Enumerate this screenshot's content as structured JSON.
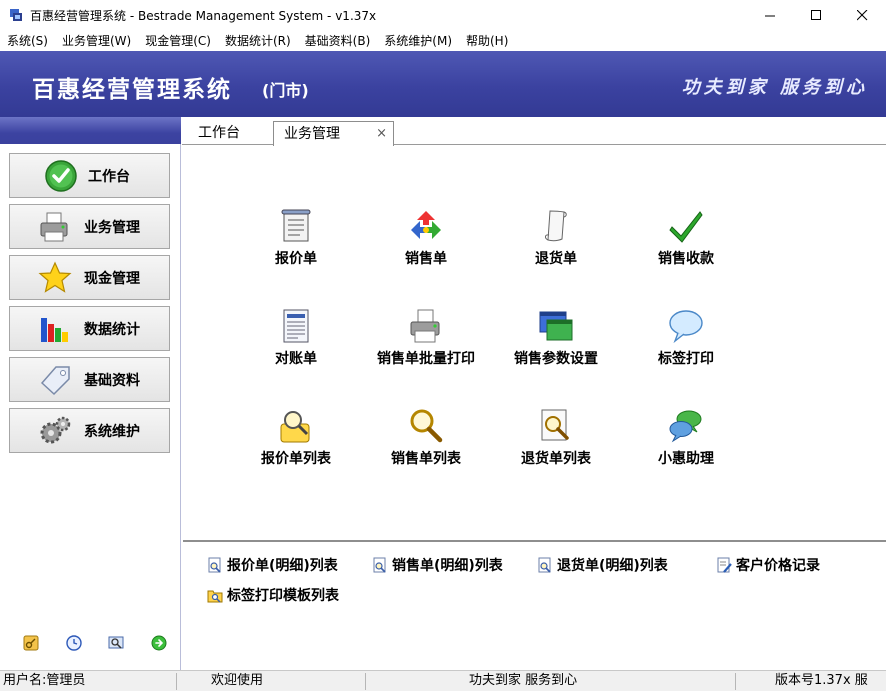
{
  "window": {
    "title": "百惠经营管理系统 - Bestrade Management System - v1.37x",
    "icon": "app-icon"
  },
  "menu": [
    {
      "label": "系统(S)"
    },
    {
      "label": "业务管理(W)"
    },
    {
      "label": "现金管理(C)"
    },
    {
      "label": "数据统计(R)"
    },
    {
      "label": "基础资料(B)"
    },
    {
      "label": "系统维护(M)"
    },
    {
      "label": "帮助(H)"
    }
  ],
  "banner": {
    "name": "百惠经营管理系统",
    "subtitle": "(门市)",
    "slogan": "功夫到家 服务到心",
    "color": "#3b42a0"
  },
  "sidebar": {
    "items": [
      {
        "label": "工作台",
        "icon": "check-circle-icon"
      },
      {
        "label": "业务管理",
        "icon": "printer-icon"
      },
      {
        "label": "现金管理",
        "icon": "star-icon"
      },
      {
        "label": "数据统计",
        "icon": "bar-chart-icon"
      },
      {
        "label": "基础资料",
        "icon": "tag-icon"
      },
      {
        "label": "系统维护",
        "icon": "gears-icon"
      }
    ],
    "footer_icons": [
      "key-icon",
      "clock-icon",
      "search-window-icon",
      "forward-icon"
    ]
  },
  "tabs": [
    {
      "label": "工作台",
      "active": false
    },
    {
      "label": "业务管理",
      "active": true,
      "close": "×"
    }
  ],
  "tiles": [
    {
      "label": "报价单",
      "icon": "document-icon"
    },
    {
      "label": "销售单",
      "icon": "recycle-icon"
    },
    {
      "label": "退货单",
      "icon": "scroll-icon"
    },
    {
      "label": "销售收款",
      "icon": "checkmark-icon"
    },
    {
      "label": "对账单",
      "icon": "list-document-icon"
    },
    {
      "label": "销售单批量打印",
      "icon": "printer-icon"
    },
    {
      "label": "销售参数设置",
      "icon": "window-settings-icon"
    },
    {
      "label": "标签打印",
      "icon": "speech-bubble-icon"
    },
    {
      "label": "报价单列表",
      "icon": "user-search-icon"
    },
    {
      "label": "销售单列表",
      "icon": "magnifier-icon"
    },
    {
      "label": "退货单列表",
      "icon": "document-search-icon"
    },
    {
      "label": "小惠助理",
      "icon": "chat-bubbles-icon"
    }
  ],
  "links": [
    {
      "label": "报价单(明细)列表",
      "icon": "search-doc-icon"
    },
    {
      "label": "销售单(明细)列表",
      "icon": "search-doc-icon"
    },
    {
      "label": "退货单(明细)列表",
      "icon": "search-doc-icon"
    },
    {
      "label": "客户价格记录",
      "icon": "edit-doc-icon"
    },
    {
      "label": "标签打印模板列表",
      "icon": "folder-search-icon"
    }
  ],
  "status": {
    "user": "用户名:管理员",
    "welcome": "欢迎使用",
    "slogan": "功夫到家 服务到心",
    "version": "版本号1.37x 服"
  }
}
